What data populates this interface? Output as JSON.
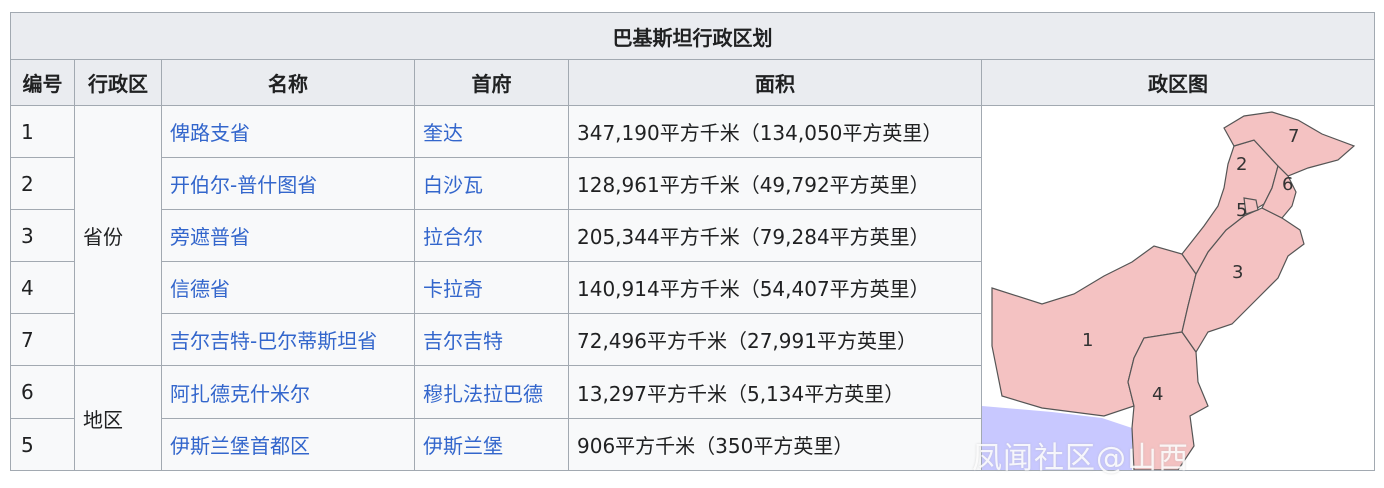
{
  "table": {
    "caption": "巴基斯坦行政区划",
    "headers": [
      "编号",
      "行政区",
      "名称",
      "首府",
      "面积",
      "政区图"
    ],
    "groups": [
      {
        "type": "省份",
        "rows": [
          {
            "num": "1",
            "name": "俾路支省",
            "capital": "奎达",
            "area": "347,190平方千米（134,050平方英里）"
          },
          {
            "num": "2",
            "name": "开伯尔-普什图省",
            "capital": "白沙瓦",
            "area": "128,961平方千米（49,792平方英里）"
          },
          {
            "num": "3",
            "name": "旁遮普省",
            "capital": "拉合尔",
            "area": "205,344平方千米（79,284平方英里）"
          },
          {
            "num": "4",
            "name": "信德省",
            "capital": "卡拉奇",
            "area": "140,914平方千米（54,407平方英里）"
          },
          {
            "num": "7",
            "name": "吉尔吉特-巴尔蒂斯坦省",
            "capital": "吉尔吉特",
            "area": "72,496平方千米（27,991平方英里）"
          }
        ]
      },
      {
        "type": "地区",
        "rows": [
          {
            "num": "6",
            "name": "阿扎德克什米尔",
            "capital": "穆扎法拉巴德",
            "area": "13,297平方千米（5,134平方英里）"
          },
          {
            "num": "5",
            "name": "伊斯兰堡首都区",
            "capital": "伊斯兰堡",
            "area": "906平方千米（350平方英里）"
          }
        ]
      }
    ]
  },
  "map": {
    "labels": [
      "1",
      "2",
      "3",
      "4",
      "5",
      "6",
      "7"
    ],
    "land_color": "#f4c2c2",
    "sea_color": "#c8c8ff",
    "border_color": "#555555"
  },
  "watermark": "凤闻社区@山西"
}
